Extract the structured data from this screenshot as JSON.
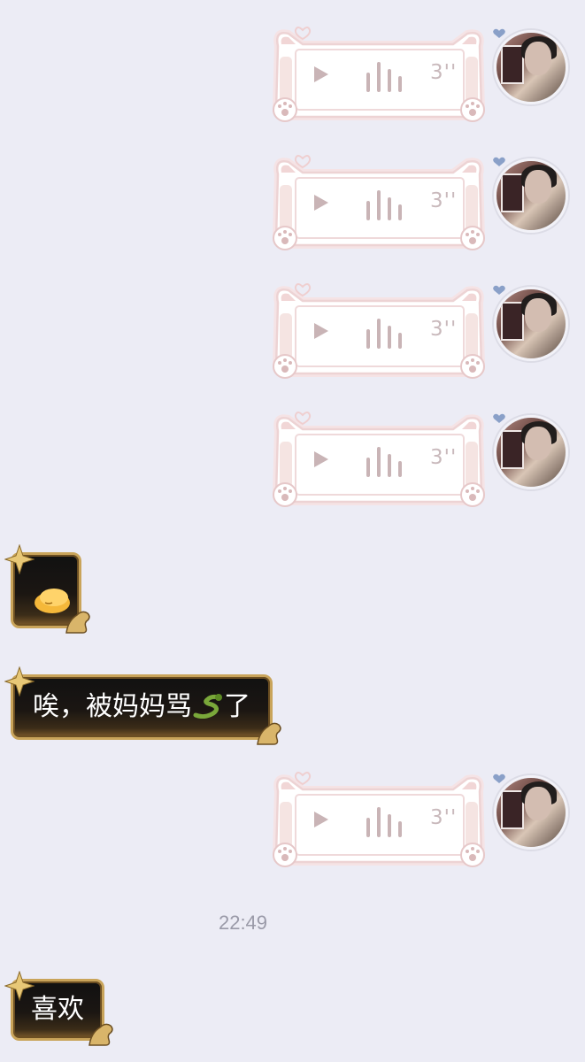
{
  "screen": {
    "background": "#ececf5"
  },
  "outgoing_voice_messages": [
    {
      "duration": "3''",
      "play_icon": "play-icon",
      "waveform_icon": "waveform-icon"
    },
    {
      "duration": "3''",
      "play_icon": "play-icon",
      "waveform_icon": "waveform-icon"
    },
    {
      "duration": "3''",
      "play_icon": "play-icon",
      "waveform_icon": "waveform-icon"
    },
    {
      "duration": "3''",
      "play_icon": "play-icon",
      "waveform_icon": "waveform-icon"
    },
    {
      "duration": "3''",
      "play_icon": "play-icon",
      "waveform_icon": "waveform-icon"
    }
  ],
  "incoming_messages": [
    {
      "type": "sticker",
      "icon": "sleepy-blob-emoji"
    },
    {
      "type": "text",
      "text_before": "唉，被妈妈骂",
      "emoji": "snake-emoji",
      "text_after": "了"
    },
    {
      "type": "text",
      "text": "喜欢"
    }
  ],
  "timestamp": "22:49",
  "colors": {
    "voice_bubble_accent": "#e8c9c9",
    "voice_icon": "#c9b4b6",
    "incoming_bubble_border": "#c9a45a",
    "incoming_bubble_bg": "#111111",
    "timestamp_text": "#9a9aa8"
  }
}
